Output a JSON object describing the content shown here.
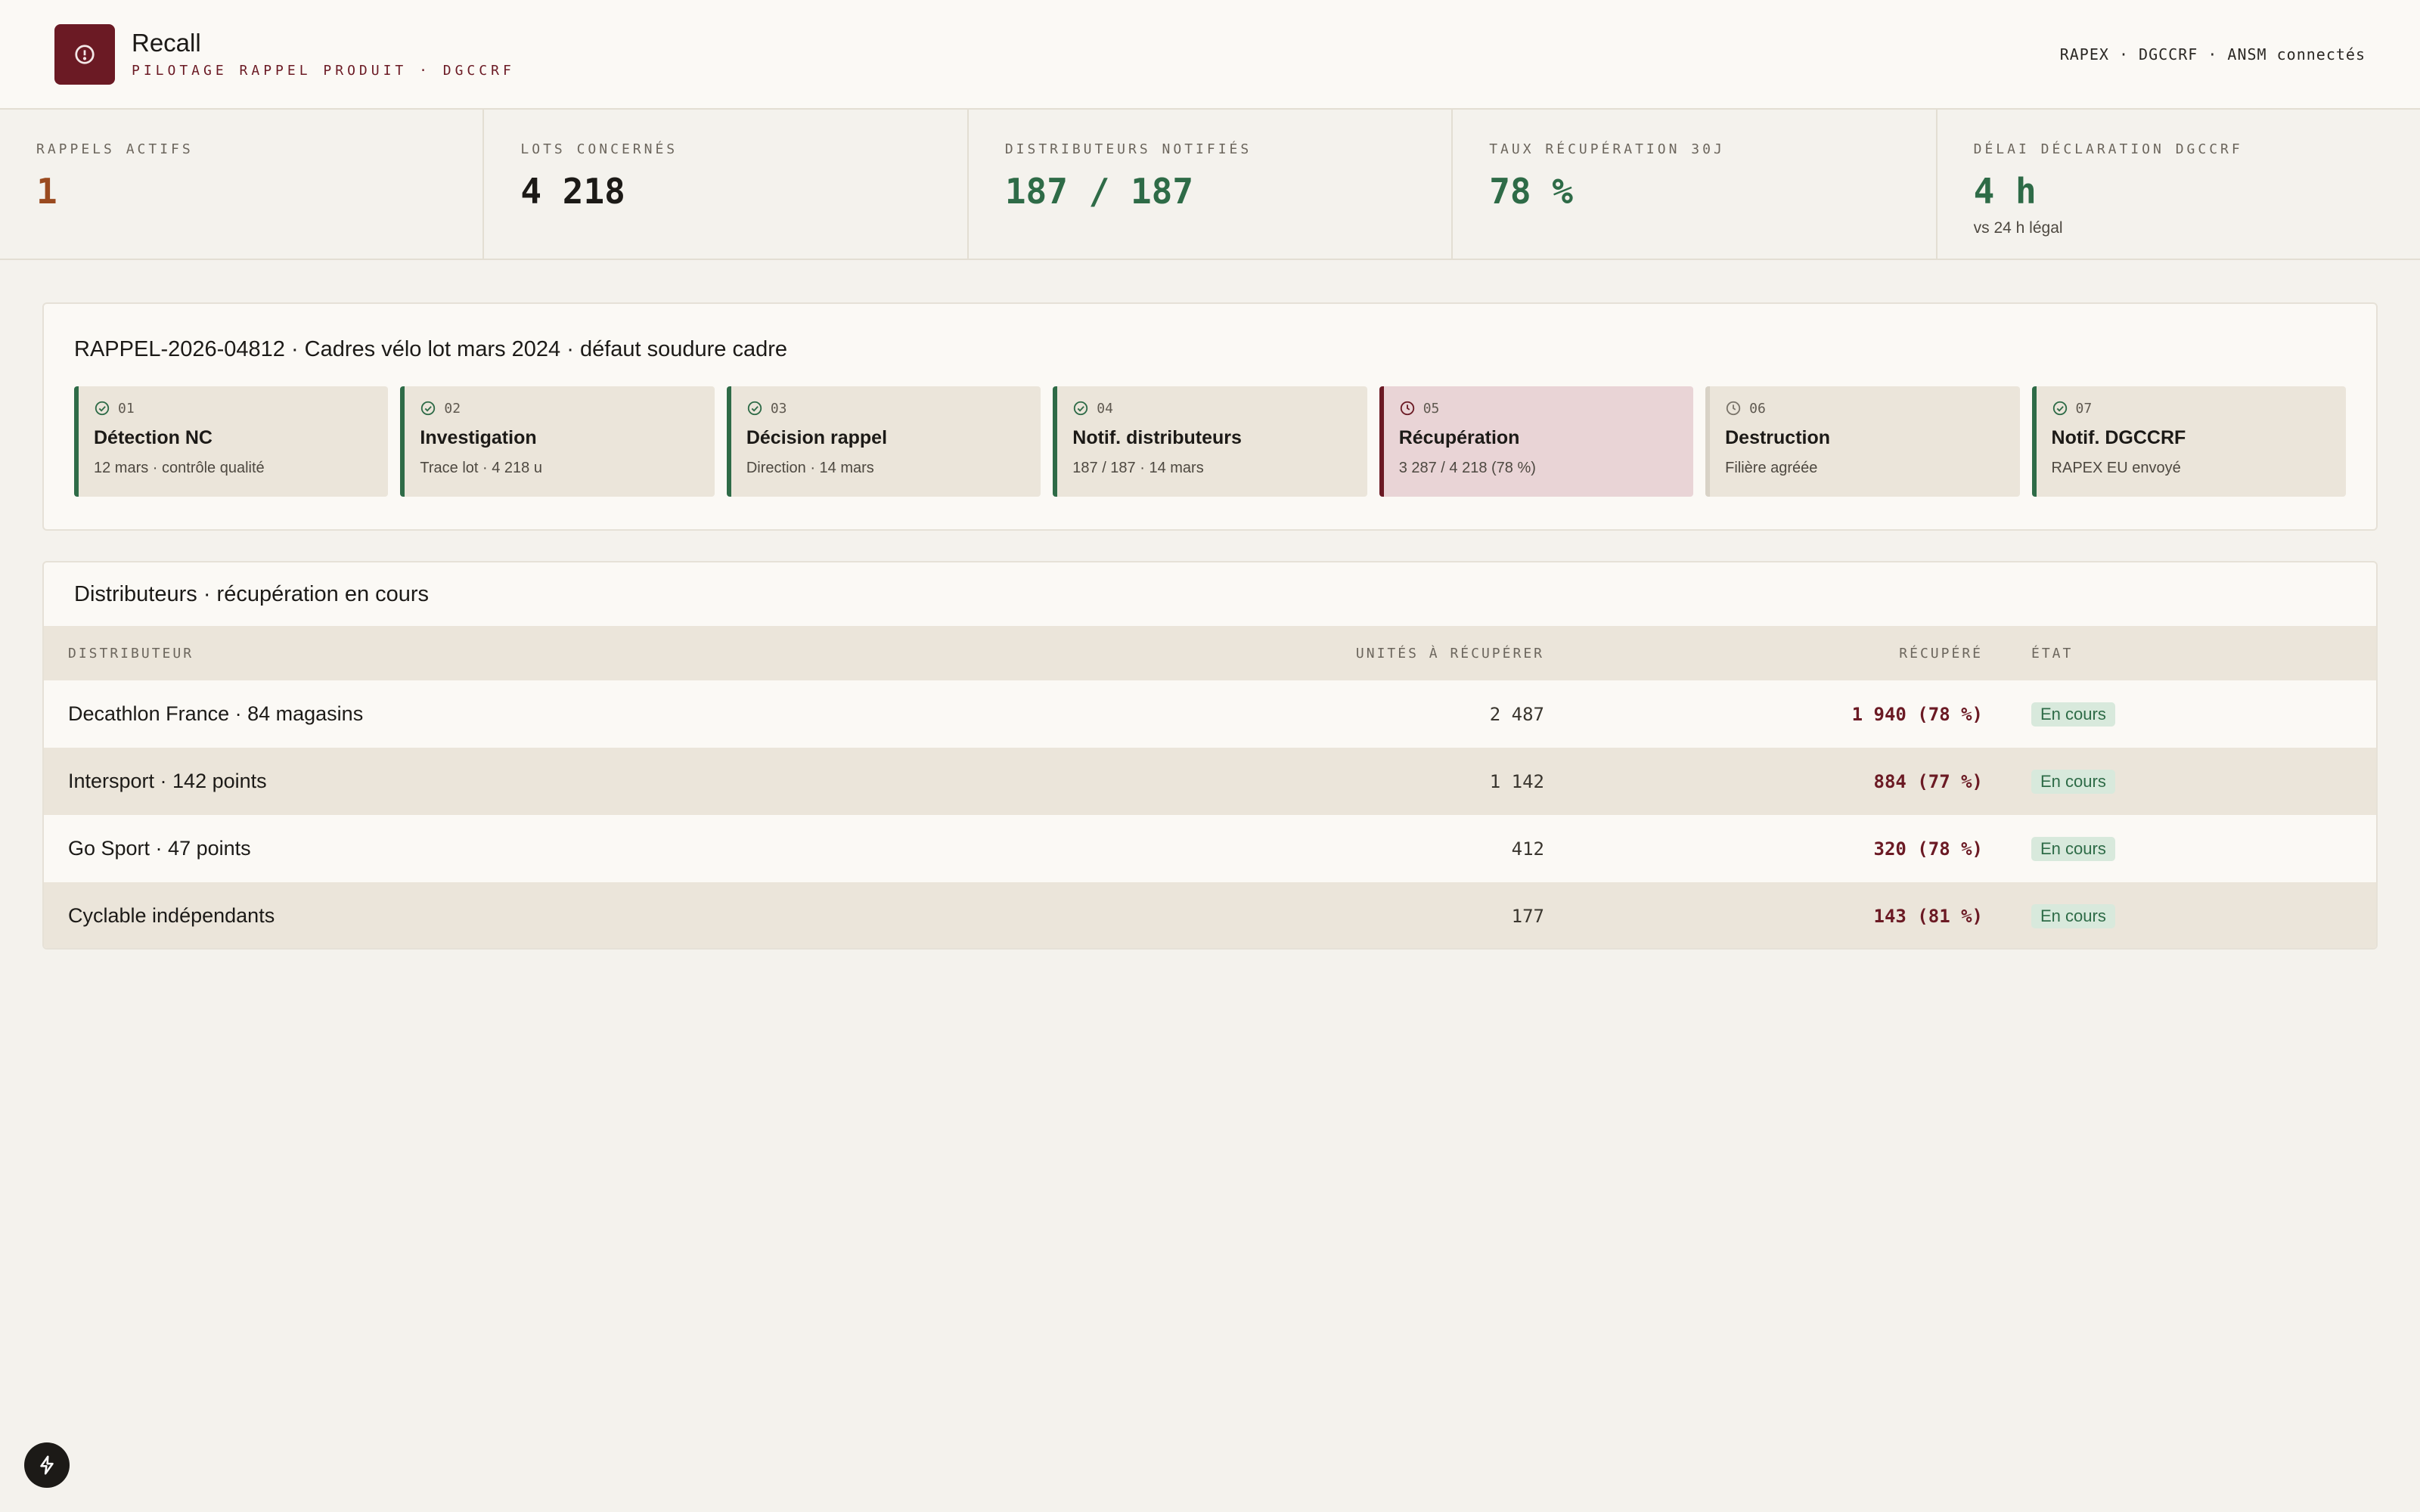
{
  "header": {
    "title": "Recall",
    "subtitle": "PILOTAGE RAPPEL PRODUIT · DGCCRF",
    "connections": "RAPEX · DGCCRF · ANSM connectés",
    "logo_icon": "alert-circle-icon"
  },
  "kpis": [
    {
      "label": "RAPPELS ACTIFS",
      "value": "1",
      "color": "#9a4a1f",
      "note": ""
    },
    {
      "label": "LOTS CONCERNÉS",
      "value": "4 218",
      "color": "#1c1a17",
      "note": ""
    },
    {
      "label": "DISTRIBUTEURS NOTIFIÉS",
      "value": "187 / 187",
      "color": "#2e6b47",
      "note": ""
    },
    {
      "label": "TAUX RÉCUPÉRATION 30J",
      "value": "78 %",
      "color": "#2e6b47",
      "note": ""
    },
    {
      "label": "DÉLAI DÉCLARATION DGCCRF",
      "value": "4 h",
      "color": "#2e6b47",
      "note": "vs 24 h légal"
    }
  ],
  "recall": {
    "title": "RAPPEL-2026-04812 · Cadres vélo lot mars 2024 · défaut soudure cadre",
    "steps": [
      {
        "num": "01",
        "title": "Détection NC",
        "sub": "12 mars · contrôle qualité",
        "status": "done"
      },
      {
        "num": "02",
        "title": "Investigation",
        "sub": "Trace lot · 4 218 u",
        "status": "done"
      },
      {
        "num": "03",
        "title": "Décision rappel",
        "sub": "Direction · 14 mars",
        "status": "done"
      },
      {
        "num": "04",
        "title": "Notif. distributeurs",
        "sub": "187 / 187 · 14 mars",
        "status": "done"
      },
      {
        "num": "05",
        "title": "Récupération",
        "sub": "3 287 / 4 218 (78 %)",
        "status": "current"
      },
      {
        "num": "06",
        "title": "Destruction",
        "sub": "Filière agréée",
        "status": "pending"
      },
      {
        "num": "07",
        "title": "Notif. DGCCRF",
        "sub": "RAPEX EU envoyé",
        "status": "done"
      }
    ]
  },
  "distributors": {
    "title": "Distributeurs · récupération en cours",
    "columns": [
      "DISTRIBUTEUR",
      "UNITÉS À RÉCUPÉRER",
      "RÉCUPÉRÉ",
      "ÉTAT"
    ],
    "rows": [
      {
        "name": "Decathlon France · 84 magasins",
        "units": "2 487",
        "recovered": "1 940 (78 %)",
        "state": "En cours"
      },
      {
        "name": "Intersport · 142 points",
        "units": "1 142",
        "recovered": "884 (77 %)",
        "state": "En cours"
      },
      {
        "name": "Go Sport · 47 points",
        "units": "412",
        "recovered": "320 (78 %)",
        "state": "En cours"
      },
      {
        "name": "Cyclable indépendants",
        "units": "177",
        "recovered": "143 (81 %)",
        "state": "En cours"
      }
    ]
  },
  "fab_icon": "bolt-icon"
}
